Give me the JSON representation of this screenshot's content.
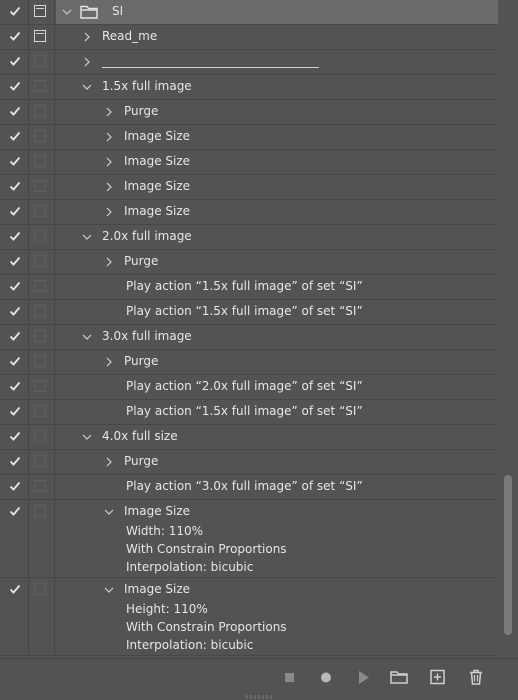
{
  "actions_panel": {
    "rows": [
      {
        "kind": "set",
        "check": true,
        "dialog": "on",
        "label": "SI",
        "expanded": true
      },
      {
        "kind": "action",
        "check": true,
        "dialog": "on",
        "label": "Read_me",
        "expanded": false
      },
      {
        "kind": "action-line",
        "check": true,
        "dialog": "off",
        "label": "",
        "expanded": false
      },
      {
        "kind": "action",
        "check": true,
        "dialog": "off",
        "label": "1.5x full image",
        "expanded": true
      },
      {
        "kind": "step",
        "check": true,
        "dialog": "off",
        "label": "Purge",
        "arrow": true
      },
      {
        "kind": "step",
        "check": true,
        "dialog": "off",
        "label": "Image Size",
        "arrow": true
      },
      {
        "kind": "step",
        "check": true,
        "dialog": "off",
        "label": "Image Size",
        "arrow": true
      },
      {
        "kind": "step",
        "check": true,
        "dialog": "off",
        "label": "Image Size",
        "arrow": true
      },
      {
        "kind": "step",
        "check": true,
        "dialog": "off",
        "label": "Image Size",
        "arrow": true
      },
      {
        "kind": "action",
        "check": true,
        "dialog": "off",
        "label": "2.0x full image",
        "expanded": true
      },
      {
        "kind": "step",
        "check": true,
        "dialog": "off",
        "label": "Purge",
        "arrow": true
      },
      {
        "kind": "step",
        "check": true,
        "dialog": "off",
        "label": "Play action “1.5x full image” of set “SI”",
        "arrow": false
      },
      {
        "kind": "step",
        "check": true,
        "dialog": "off",
        "label": "Play action “1.5x full image” of set “SI”",
        "arrow": false
      },
      {
        "kind": "action",
        "check": true,
        "dialog": "off",
        "label": "3.0x full image",
        "expanded": true
      },
      {
        "kind": "step",
        "check": true,
        "dialog": "off",
        "label": "Purge",
        "arrow": true
      },
      {
        "kind": "step",
        "check": true,
        "dialog": "off",
        "label": "Play action “2.0x full image” of set “SI”",
        "arrow": false
      },
      {
        "kind": "step",
        "check": true,
        "dialog": "off",
        "label": "Play action “1.5x full image” of set “SI”",
        "arrow": false
      },
      {
        "kind": "action",
        "check": true,
        "dialog": "off",
        "label": "4.0x full size",
        "expanded": true
      },
      {
        "kind": "step",
        "check": true,
        "dialog": "off",
        "label": "Purge",
        "arrow": true
      },
      {
        "kind": "step",
        "check": true,
        "dialog": "off",
        "label": "Play action “3.0x full image” of set “SI”",
        "arrow": false
      },
      {
        "kind": "step-expanded",
        "check": true,
        "dialog": "off",
        "label": "Image Size",
        "details": [
          "Width: 110%",
          "With Constrain Proportions",
          "Interpolation: bicubic"
        ]
      },
      {
        "kind": "step-expanded",
        "check": true,
        "dialog": "off",
        "label": "Image Size",
        "details": [
          "Height: 110%",
          "With Constrain Proportions",
          "Interpolation: bicubic"
        ]
      }
    ]
  },
  "toolbar": {
    "buttons": [
      {
        "name": "stop-button",
        "icon": "stop-icon"
      },
      {
        "name": "record-button",
        "icon": "record-icon"
      },
      {
        "name": "play-button",
        "icon": "play-icon"
      },
      {
        "name": "new-set-button",
        "icon": "folder-icon"
      },
      {
        "name": "new-action-button",
        "icon": "plus-square-icon"
      },
      {
        "name": "delete-button",
        "icon": "trash-icon"
      }
    ]
  },
  "colors": {
    "panel_bg": "#535353",
    "selected_row": "#6a6a6a",
    "text": "#e6e6e6",
    "icon": "#cfcfcf"
  }
}
